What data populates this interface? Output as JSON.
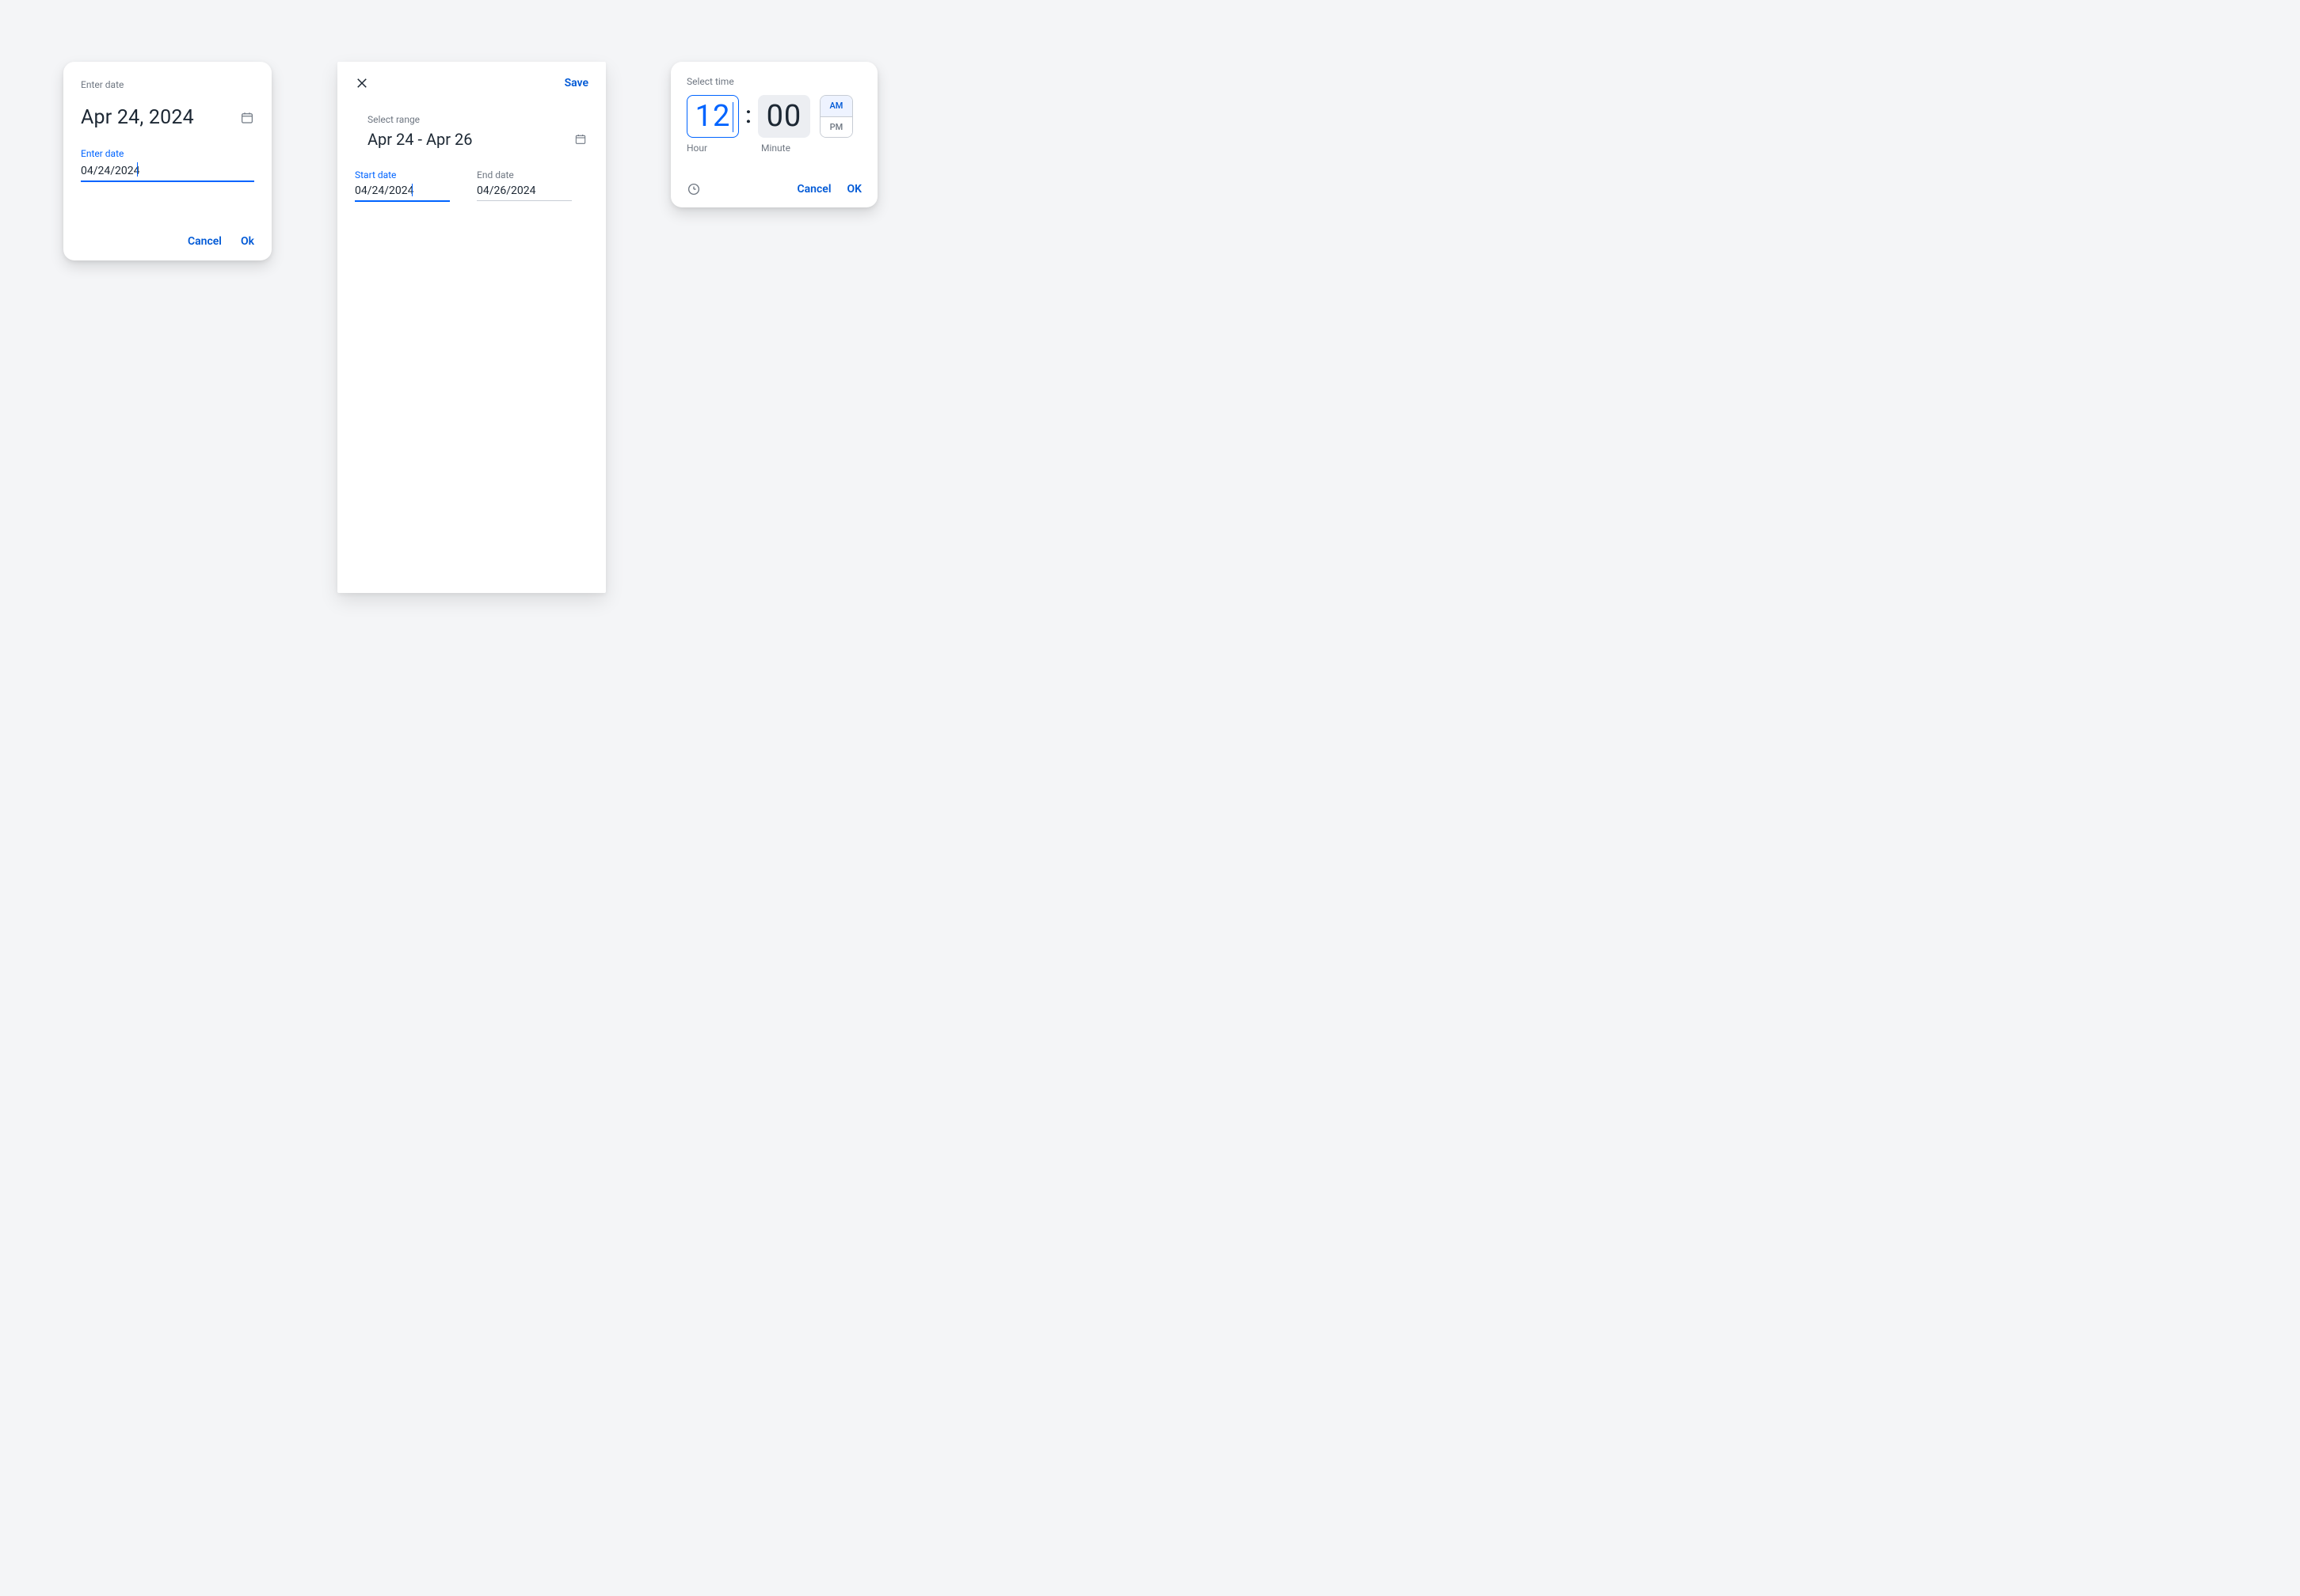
{
  "datePicker": {
    "title": "Enter date",
    "display": "Apr 24, 2024",
    "fieldLabel": "Enter date",
    "fieldValue": "04/24/2024",
    "cancel": "Cancel",
    "ok": "Ok"
  },
  "rangePicker": {
    "save": "Save",
    "title": "Select range",
    "display": "Apr 24 - Apr 26",
    "startLabel": "Start date",
    "startValue": "04/24/2024",
    "endLabel": "End date",
    "endValue": "04/26/2024"
  },
  "timePicker": {
    "title": "Select time",
    "hour": "12",
    "minute": "00",
    "hourLabel": "Hour",
    "minuteLabel": "Minute",
    "am": "AM",
    "pm": "PM",
    "selectedPeriod": "AM",
    "cancel": "Cancel",
    "ok": "OK"
  }
}
